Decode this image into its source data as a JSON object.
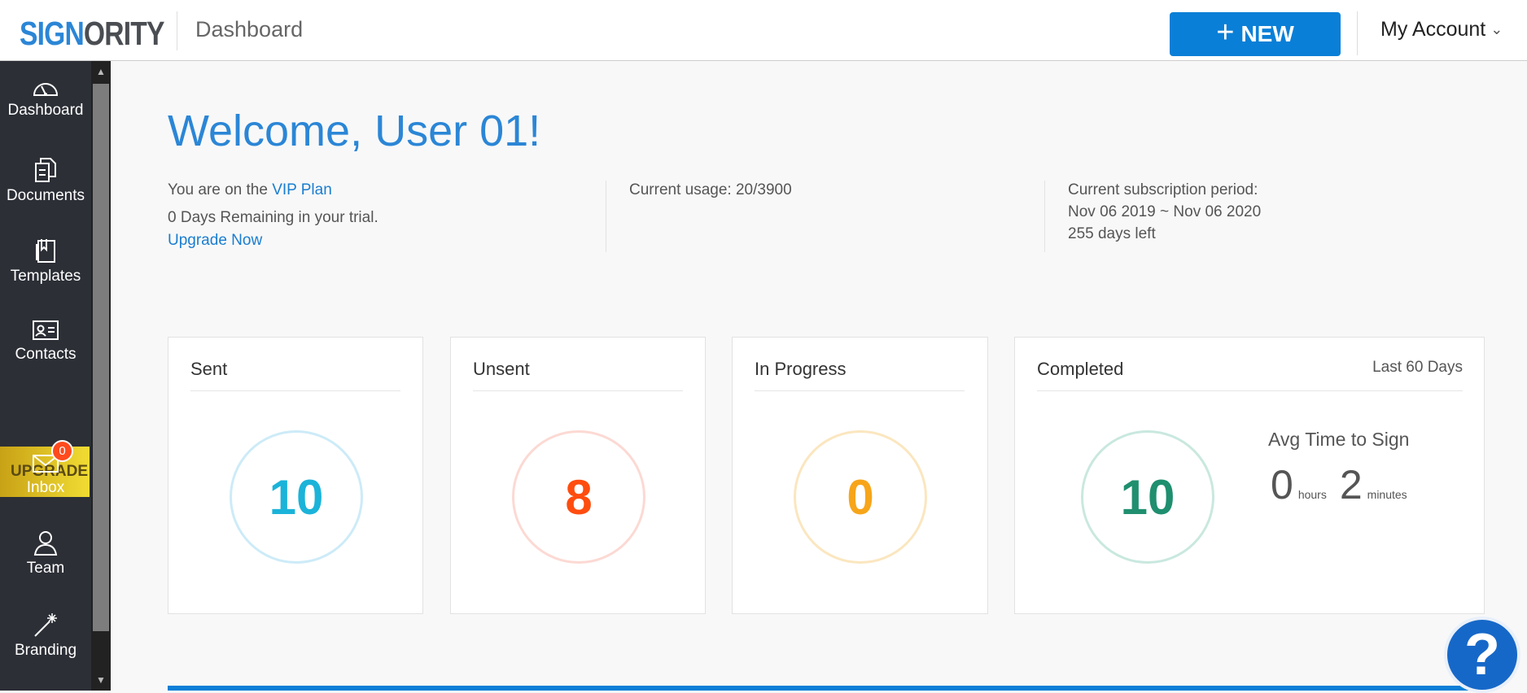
{
  "header": {
    "logo_part1": "SIGN",
    "logo_part2": "ORITY",
    "page_title": "Dashboard",
    "new_button": "NEW",
    "account": "My Account"
  },
  "sidebar": {
    "items": [
      {
        "label": "Dashboard",
        "icon": "gauge-icon"
      },
      {
        "label": "Documents",
        "icon": "documents-icon"
      },
      {
        "label": "Templates",
        "icon": "templates-icon"
      },
      {
        "label": "Contacts",
        "icon": "contact-card-icon"
      },
      {
        "label": "Inbox",
        "icon": "envelope-icon"
      },
      {
        "label": "Team",
        "icon": "user-icon"
      },
      {
        "label": "Branding",
        "icon": "magic-wand-icon"
      }
    ],
    "upgrade": "UPGRADE",
    "inbox_badge": "0"
  },
  "welcome": "Welcome, User 01!",
  "plan": {
    "prefix": "You are on the ",
    "plan_name": "VIP Plan",
    "trial": "0 Days Remaining in your trial.",
    "upgrade_link": "Upgrade Now"
  },
  "usage": "Current usage: 20/3900",
  "subscription": {
    "label": "Current subscription period:",
    "period": "Nov 06 2019 ~ Nov 06 2020",
    "days_left": "255 days left"
  },
  "cards": {
    "sent": {
      "title": "Sent",
      "value": "10",
      "color": "#1bb3d9",
      "ring": "#cdebf8"
    },
    "unsent": {
      "title": "Unsent",
      "value": "8",
      "color": "#ff4d0f",
      "ring": "#fcd9d3"
    },
    "in_progress": {
      "title": "In Progress",
      "value": "0",
      "color": "#f7a51a",
      "ring": "#fbe6bf"
    },
    "completed": {
      "title": "Completed",
      "value": "10",
      "color": "#1f8f6f",
      "ring": "#c9e8df",
      "period": "Last 60 Days",
      "avg_title": "Avg Time to Sign",
      "hours_value": "0",
      "hours_unit": "hours",
      "minutes_value": "2",
      "minutes_unit": "minutes"
    }
  },
  "help": "?"
}
